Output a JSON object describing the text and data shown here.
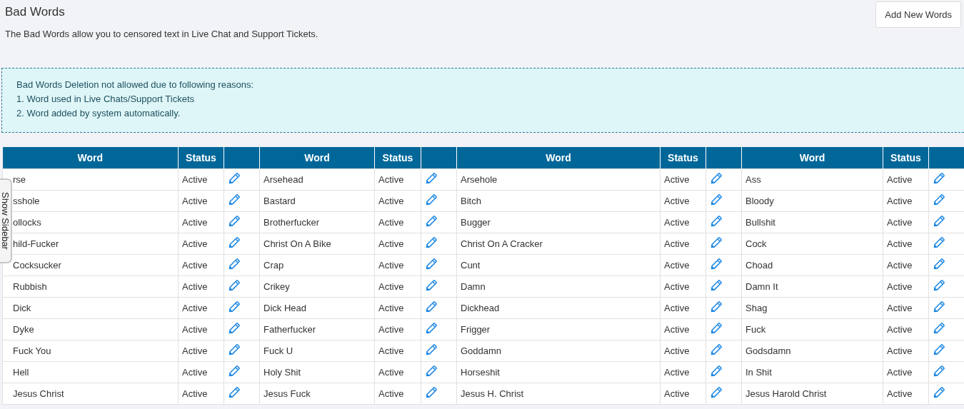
{
  "page": {
    "title": "Bad Words",
    "description": "The Bad Words allow you to censored text in Live Chat and Support Tickets.",
    "add_button": "Add New Words"
  },
  "notice": {
    "lines": [
      "Bad Words Deletion not allowed due to following reasons:",
      "1. Word used in Live Chats/Support Tickets",
      "2. Word added by system automatically."
    ]
  },
  "sidebar_toggle": {
    "label": "Show Sidebar"
  },
  "table": {
    "columns": [
      {
        "label": "Word"
      },
      {
        "label": "Status"
      },
      {
        "kind": "edit"
      },
      {
        "label": "Word"
      },
      {
        "label": "Status"
      },
      {
        "kind": "edit"
      },
      {
        "label": "Word"
      },
      {
        "label": "Status"
      },
      {
        "kind": "edit"
      },
      {
        "label": "Word"
      },
      {
        "label": "Status"
      },
      {
        "kind": "edit"
      }
    ],
    "rows": [
      {
        "cells": [
          {
            "text": "rse"
          },
          {
            "text": "Active"
          },
          {
            "kind": "edit"
          },
          {
            "text": "Arsehead"
          },
          {
            "text": "Active"
          },
          {
            "kind": "edit"
          },
          {
            "text": "Arsehole"
          },
          {
            "text": "Active"
          },
          {
            "kind": "edit"
          },
          {
            "text": "Ass"
          },
          {
            "text": "Active"
          },
          {
            "kind": "edit"
          }
        ]
      },
      {
        "cells": [
          {
            "text": "sshole"
          },
          {
            "text": "Active"
          },
          {
            "kind": "edit"
          },
          {
            "text": "Bastard"
          },
          {
            "text": "Active"
          },
          {
            "kind": "edit"
          },
          {
            "text": "Bitch"
          },
          {
            "text": "Active"
          },
          {
            "kind": "edit"
          },
          {
            "text": "Bloody"
          },
          {
            "text": "Active"
          },
          {
            "kind": "edit"
          }
        ]
      },
      {
        "cells": [
          {
            "text": "ollocks"
          },
          {
            "text": "Active"
          },
          {
            "kind": "edit"
          },
          {
            "text": "Brotherfucker"
          },
          {
            "text": "Active"
          },
          {
            "kind": "edit"
          },
          {
            "text": "Bugger"
          },
          {
            "text": "Active"
          },
          {
            "kind": "edit"
          },
          {
            "text": "Bullshit"
          },
          {
            "text": "Active"
          },
          {
            "kind": "edit"
          }
        ]
      },
      {
        "cells": [
          {
            "text": "hild-Fucker"
          },
          {
            "text": "Active"
          },
          {
            "kind": "edit"
          },
          {
            "text": "Christ On A Bike"
          },
          {
            "text": "Active"
          },
          {
            "kind": "edit"
          },
          {
            "text": "Christ On A Cracker"
          },
          {
            "text": "Active"
          },
          {
            "kind": "edit"
          },
          {
            "text": "Cock"
          },
          {
            "text": "Active"
          },
          {
            "kind": "edit"
          }
        ]
      },
      {
        "cells": [
          {
            "text": "Cocksucker"
          },
          {
            "text": "Active"
          },
          {
            "kind": "edit"
          },
          {
            "text": "Crap"
          },
          {
            "text": "Active"
          },
          {
            "kind": "edit"
          },
          {
            "text": "Cunt"
          },
          {
            "text": "Active"
          },
          {
            "kind": "edit"
          },
          {
            "text": "Choad"
          },
          {
            "text": "Active"
          },
          {
            "kind": "edit"
          }
        ]
      },
      {
        "cells": [
          {
            "text": "Rubbish"
          },
          {
            "text": "Active"
          },
          {
            "kind": "edit"
          },
          {
            "text": "Crikey"
          },
          {
            "text": "Active"
          },
          {
            "kind": "edit"
          },
          {
            "text": "Damn"
          },
          {
            "text": "Active"
          },
          {
            "kind": "edit"
          },
          {
            "text": "Damn It"
          },
          {
            "text": "Active"
          },
          {
            "kind": "edit"
          }
        ]
      },
      {
        "cells": [
          {
            "text": "Dick"
          },
          {
            "text": "Active"
          },
          {
            "kind": "edit"
          },
          {
            "text": "Dick Head"
          },
          {
            "text": "Active"
          },
          {
            "kind": "edit"
          },
          {
            "text": "Dickhead"
          },
          {
            "text": "Active"
          },
          {
            "kind": "edit"
          },
          {
            "text": "Shag"
          },
          {
            "text": "Active"
          },
          {
            "kind": "edit"
          }
        ]
      },
      {
        "cells": [
          {
            "text": "Dyke"
          },
          {
            "text": "Active"
          },
          {
            "kind": "edit"
          },
          {
            "text": "Fatherfucker"
          },
          {
            "text": "Active"
          },
          {
            "kind": "edit"
          },
          {
            "text": "Frigger"
          },
          {
            "text": "Active"
          },
          {
            "kind": "edit"
          },
          {
            "text": "Fuck"
          },
          {
            "text": "Active"
          },
          {
            "kind": "edit"
          }
        ]
      },
      {
        "cells": [
          {
            "text": "Fuck You"
          },
          {
            "text": "Active"
          },
          {
            "kind": "edit"
          },
          {
            "text": "Fuck U"
          },
          {
            "text": "Active"
          },
          {
            "kind": "edit"
          },
          {
            "text": "Goddamn"
          },
          {
            "text": "Active"
          },
          {
            "kind": "edit"
          },
          {
            "text": "Godsdamn"
          },
          {
            "text": "Active"
          },
          {
            "kind": "edit"
          }
        ]
      },
      {
        "cells": [
          {
            "text": "Hell"
          },
          {
            "text": "Active"
          },
          {
            "kind": "edit"
          },
          {
            "text": "Holy Shit"
          },
          {
            "text": "Active"
          },
          {
            "kind": "edit"
          },
          {
            "text": "Horseshit"
          },
          {
            "text": "Active"
          },
          {
            "kind": "edit"
          },
          {
            "text": "In Shit"
          },
          {
            "text": "Active"
          },
          {
            "kind": "edit"
          }
        ]
      },
      {
        "cells": [
          {
            "text": "Jesus Christ"
          },
          {
            "text": "Active"
          },
          {
            "kind": "edit"
          },
          {
            "text": "Jesus Fuck"
          },
          {
            "text": "Active"
          },
          {
            "kind": "edit"
          },
          {
            "text": "Jesus H. Christ"
          },
          {
            "text": "Active"
          },
          {
            "kind": "edit"
          },
          {
            "text": "Jesus Harold Christ"
          },
          {
            "text": "Active"
          },
          {
            "kind": "edit"
          }
        ]
      }
    ]
  }
}
